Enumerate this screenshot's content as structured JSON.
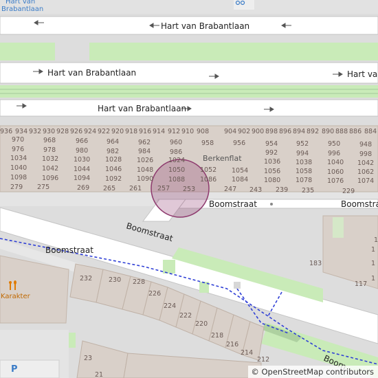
{
  "map": {
    "streets": {
      "hart_top": "Hart van Brabantlaan",
      "hart_mid": "Hart van Brabantlaan",
      "hart_mid_right": "Hart van",
      "hart_low": "Hart van Brabantlaan",
      "boomstraat_diag": "Boomstraat",
      "boomstraat_right_1": "Boomstraat",
      "boomstraat_right_2": "Boomstraat",
      "boomstraat_left": "Boomstraat",
      "boomstraat_corner": "Boom"
    },
    "places": {
      "top_label_1": "Hart van",
      "top_label_2": "Brabantlaan",
      "karakter": "Karakter",
      "berkenflat": "Berkenflat",
      "parking": "P"
    },
    "house_numbers": {
      "row1": [
        "936",
        "934",
        "932",
        "930",
        "928",
        "926",
        "924",
        "922",
        "920",
        "918",
        "916",
        "914",
        "912",
        "910",
        "908",
        "904",
        "902",
        "900",
        "898",
        "896",
        "894",
        "892",
        "890",
        "888",
        "886",
        "884"
      ],
      "row2": [
        "970",
        "968",
        "966",
        "964",
        "962",
        "960",
        "958",
        "956",
        "954",
        "952",
        "950",
        "948"
      ],
      "row3": [
        "976",
        "978",
        "980",
        "982",
        "984",
        "986",
        "992",
        "994",
        "996",
        "998"
      ],
      "row4": [
        "1034",
        "1032",
        "1030",
        "1028",
        "1026",
        "1024",
        "1036",
        "1038",
        "1040",
        "1042",
        "1044",
        "1046"
      ],
      "row5": [
        "1040",
        "1042",
        "1044",
        "1046",
        "1048",
        "1050",
        "1052",
        "1054",
        "1056",
        "1058",
        "1060",
        "1062"
      ],
      "row6": [
        "1098",
        "1096",
        "1094",
        "1092",
        "1090",
        "1088",
        "1086",
        "1084",
        "1080",
        "1078",
        "1076",
        "1074"
      ],
      "row7": [
        "279",
        "275",
        "269",
        "265",
        "261",
        "257",
        "253",
        "247",
        "243",
        "239",
        "235",
        "229"
      ],
      "buildings_right": [
        "183",
        "117",
        "1",
        "1",
        "1",
        "1"
      ],
      "buildings_left": [
        "232",
        "230",
        "228",
        "226",
        "224",
        "222",
        "220",
        "218",
        "216",
        "214",
        "212",
        "23",
        "21"
      ]
    },
    "marker": {
      "color": "#8e3a6e"
    }
  },
  "attribution": {
    "copyright": "©",
    "text": "OpenStreetMap contributors"
  }
}
